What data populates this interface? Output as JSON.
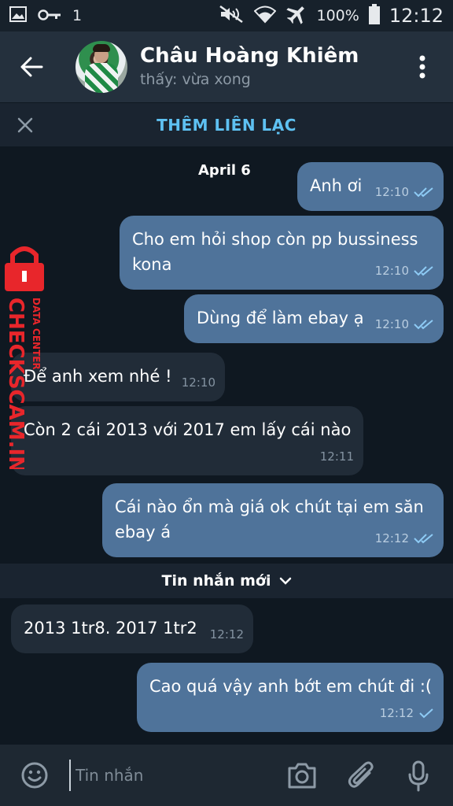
{
  "status_bar": {
    "notification_count": "1",
    "battery": "100%",
    "clock": "12:12"
  },
  "header": {
    "contact_name": "Châu Hoàng Khiêm",
    "contact_status": "thấy: vừa xong"
  },
  "add_contact": {
    "label": "THÊM LIÊN LẠC"
  },
  "chat": {
    "date": "April 6",
    "messages": [
      {
        "dir": "out",
        "text": "Anh ơi",
        "time": "12:10",
        "read": true
      },
      {
        "dir": "out",
        "text_line1": "Cho em hỏi shop còn pp bussiness",
        "text_line2": "kona",
        "time": "12:10",
        "read": true
      },
      {
        "dir": "out",
        "text": "Dùng để làm ebay ạ",
        "time": "12:10",
        "read": true
      },
      {
        "dir": "in",
        "text": "Để anh xem nhé !",
        "time": "12:10"
      },
      {
        "dir": "in",
        "text": "Còn 2 cái 2013 với 2017 em lấy cái nào",
        "time": "12:11"
      },
      {
        "dir": "out",
        "text_line1": "Cái nào ổn mà giá ok chút tại em săn",
        "text_line2": "ebay á",
        "time": "12:12",
        "read": true
      },
      {
        "dir": "in",
        "text": "2013 1tr8. 2017 1tr2",
        "time": "12:12"
      },
      {
        "dir": "out",
        "text": "Cao quá vậy anh bớt em chút đi :(",
        "time": "12:12",
        "read": false
      }
    ],
    "new_messages_label": "Tin nhắn mới"
  },
  "watermark": {
    "brand": "CHECKSCAM.INFO",
    "sub": "DATA CENTER",
    "color": "#e8262b"
  },
  "input_bar": {
    "placeholder": "Tin nhắn"
  },
  "colors": {
    "outgoing_bubble": "#4f739a",
    "incoming_bubble": "#212c38",
    "accent": "#5ec1f2",
    "background": "#0f1821"
  }
}
